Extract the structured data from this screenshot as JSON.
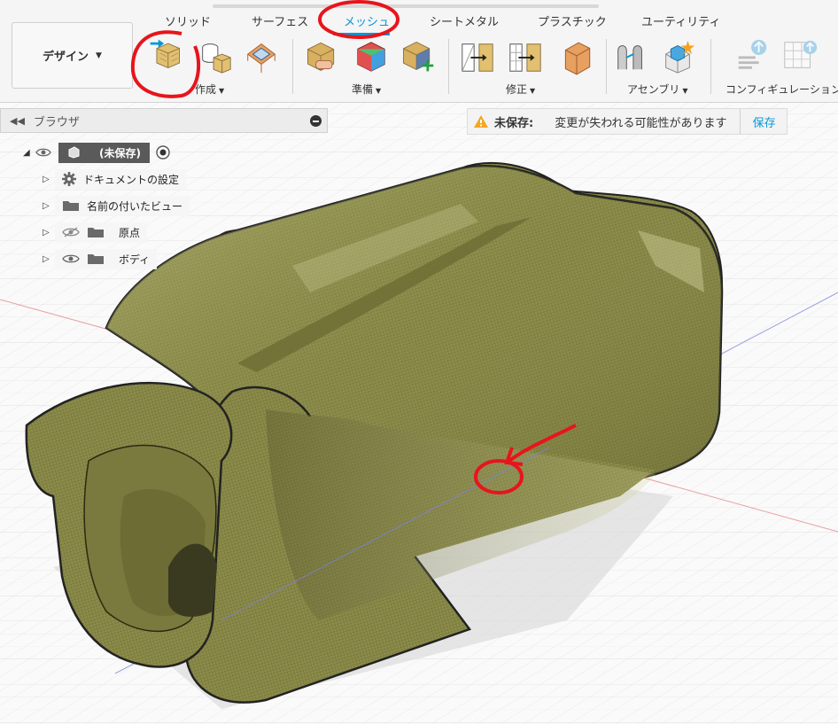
{
  "toolbar": {
    "tabs": [
      {
        "label": "ソリッド",
        "active": false
      },
      {
        "label": "サーフェス",
        "active": false
      },
      {
        "label": "メッシュ",
        "active": true
      },
      {
        "label": "シートメタル",
        "active": false
      },
      {
        "label": "プラスチック",
        "active": false
      },
      {
        "label": "ユーティリティ",
        "active": false
      }
    ],
    "workspace_button": "デザイン",
    "groups": [
      {
        "label": "作成"
      },
      {
        "label": "準備"
      },
      {
        "label": "修正"
      },
      {
        "label": "アセンブリ"
      },
      {
        "label": "コンフィギュレーション"
      }
    ],
    "accent_color": "#0696d7"
  },
  "browser": {
    "title": "ブラウザ",
    "root_label": "(未保存)",
    "items": [
      {
        "label": "ドキュメントの設定",
        "icon": "gear-icon"
      },
      {
        "label": "名前の付いたビュー",
        "icon": "folder-icon"
      },
      {
        "label": "原点",
        "icon": "folder-icon",
        "visibility": "hidden"
      },
      {
        "label": "ボディ",
        "icon": "folder-icon",
        "visibility": "visible"
      }
    ]
  },
  "unsaved": {
    "title": "未保存:",
    "message": "変更が失われる可能性があります",
    "save_label": "保存"
  },
  "viewport": {
    "model_color": "#8a8a48",
    "annotation_color": "#e8141c"
  }
}
